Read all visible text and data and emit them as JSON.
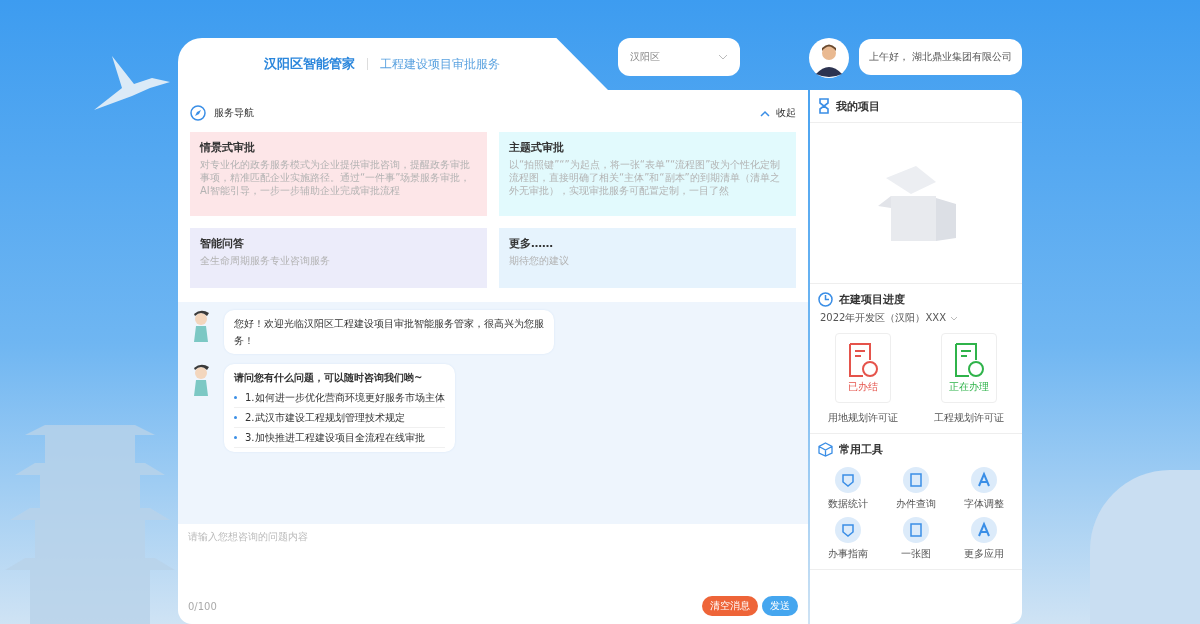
{
  "header": {
    "brand": "汉阳区智能管家",
    "subtitle": "工程建设项目审批服务",
    "district": {
      "value": "汉阳区"
    },
    "greeting": "上午好， 湖北鼎业集团有限公司"
  },
  "nav": {
    "title": "服务导航",
    "collapse": "收起",
    "cards": [
      {
        "title": "情景式审批",
        "desc": "对专业化的政务服务模式为企业提供审批咨询，提醒政务审批事项，精准匹配企业实施路径。通过“一件事”场景服务审批，AI智能引导，一步一步辅助企业完成审批流程",
        "color": "#fde6e8"
      },
      {
        "title": "主题式审批",
        "desc": "以“拍照键”“”为起点，将一张“表单”“流程图”改为个性化定制流程图，直接明确了相关“主体”和“副本”的到期清单（清单之外无审批），实现审批服务可配置定制，一目了然",
        "color": "#e2fafd"
      },
      {
        "title": "智能问答",
        "desc": "全生命周期服务专业咨询服务",
        "color": "#ececfa"
      },
      {
        "title": "更多……",
        "desc": "期待您的建议",
        "color": "#e6f3fd"
      }
    ]
  },
  "chat": {
    "messages": [
      {
        "kind": "text",
        "text": "您好！欢迎光临汉阳区工程建设项目审批智能服务管家，很高兴为您服务！"
      },
      {
        "kind": "list",
        "text": "请问您有什么问题，可以随时咨询我们哟~",
        "items": [
          "1.如何进一步优化营商环境更好服务市场主体",
          "2.武汉市建设工程规划管理技术规定",
          "3.加快推进工程建设项目全流程在线审批"
        ]
      }
    ],
    "input": {
      "placeholder": "请输入您想咨询的问题内容"
    },
    "counter": "0/100",
    "clear_button": "清空消息",
    "send_button": "发送"
  },
  "my_projects": {
    "title": "我的项目"
  },
  "progress": {
    "title": "在建项目进度",
    "project": "2022年开发区（汉阳）XXX",
    "items": [
      {
        "status": "已办结",
        "name": "用地规划许可证",
        "color": "#e5534b"
      },
      {
        "status": "正在办理",
        "name": "工程规划许可证",
        "color": "#2fb34a"
      }
    ]
  },
  "tools": {
    "title": "常用工具",
    "items": [
      "数据统计",
      "办件查询",
      "字体调整",
      "办事指南",
      "一张图",
      "更多应用"
    ]
  }
}
